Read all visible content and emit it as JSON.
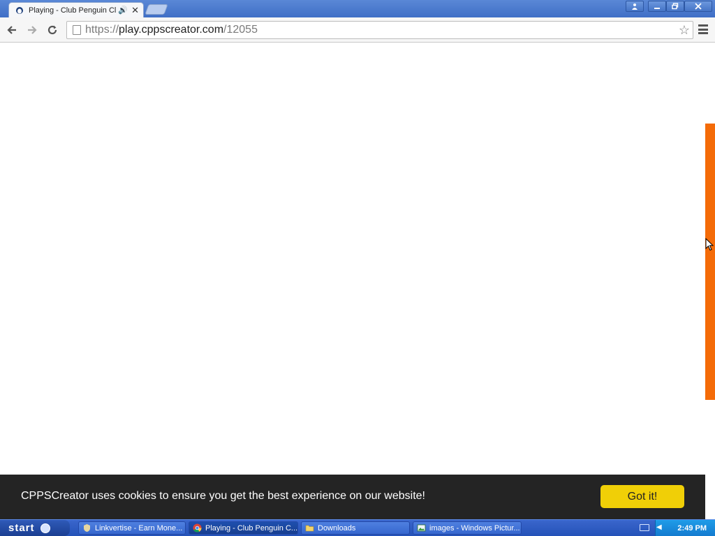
{
  "browser": {
    "tab": {
      "title": "Playing - Club Penguin Cla",
      "audio_icon": "speaker-icon",
      "close_icon": "close-icon"
    },
    "window_controls": {
      "user": "user-icon",
      "minimize": "minimize-icon",
      "restore": "restore-icon",
      "close": "close-icon"
    },
    "omnibox": {
      "url_prefix": "https://",
      "url_host": "play.cppscreator.com",
      "url_path": "/12055"
    }
  },
  "page": {
    "cookie_banner": {
      "message": "CPPSCreator uses cookies to ensure you get the best experience on our website!",
      "button_label": "Got it!"
    },
    "colors": {
      "side_tab": "#f46b08",
      "cookie_bg": "#242424",
      "cookie_button": "#f0cf07"
    }
  },
  "taskbar": {
    "start_label": "start",
    "tasks": [
      {
        "label": "Linkvertise - Earn Mone...",
        "icon": "shield-icon"
      },
      {
        "label": "Playing - Club Penguin C...",
        "icon": "chrome-icon",
        "active": true
      },
      {
        "label": "Downloads",
        "icon": "folder-icon"
      },
      {
        "label": "images - Windows Pictur...",
        "icon": "image-viewer-icon"
      }
    ],
    "clock": "2:49 PM"
  }
}
